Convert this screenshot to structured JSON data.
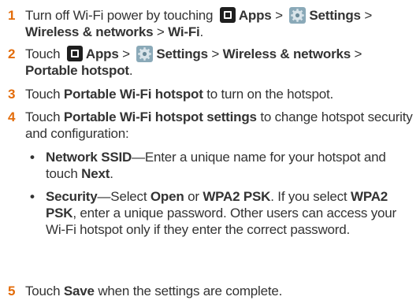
{
  "accent_color": "#e36c0a",
  "steps": [
    {
      "number": "1",
      "parts": {
        "p1": "Turn off Wi-Fi power by touching",
        "apps": "Apps",
        "gt1": ">",
        "settings": "Settings",
        "gt2": ">",
        "wireless": "Wireless & networks",
        "gt3": ">",
        "wifi": "Wi-Fi",
        "end": "."
      }
    },
    {
      "number": "2",
      "parts": {
        "p1": "Touch",
        "apps": "Apps",
        "gt1": ">",
        "settings": "Settings",
        "gt2": ">",
        "wireless": "Wireless & networks",
        "gt3": ">",
        "hotspot": "Portable hotspot",
        "end": "."
      }
    },
    {
      "number": "3",
      "parts": {
        "p1": "Touch",
        "bold": "Portable Wi-Fi hotspot",
        "p2": "to turn on the hotspot."
      }
    },
    {
      "number": "4",
      "parts": {
        "p1": "Touch",
        "bold": "Portable Wi-Fi hotspot settings",
        "p2": "to change hotspot security and configuration:"
      }
    },
    {
      "number": "5",
      "parts": {
        "p1": "Touch",
        "bold": "Save",
        "p2": "when the settings are complete."
      }
    }
  ],
  "bullets": [
    {
      "symbol": "•",
      "parts": {
        "label": "Network SSID",
        "p1": "—Enter a unique name for your hotspot and touch",
        "next": "Next",
        "end": "."
      }
    },
    {
      "symbol": "•",
      "parts": {
        "label": "Security",
        "p1": "—Select",
        "open": "Open",
        "or": "or",
        "wpa1": "WPA2 PSK",
        "p2": ". If you select",
        "wpa2": "WPA2 PSK",
        "p3": ", enter a unique password. Other users can access your Wi-Fi hotspot only if they enter the correct password."
      }
    }
  ],
  "icons": {
    "apps": "apps-icon",
    "settings": "settings-gear-icon"
  }
}
